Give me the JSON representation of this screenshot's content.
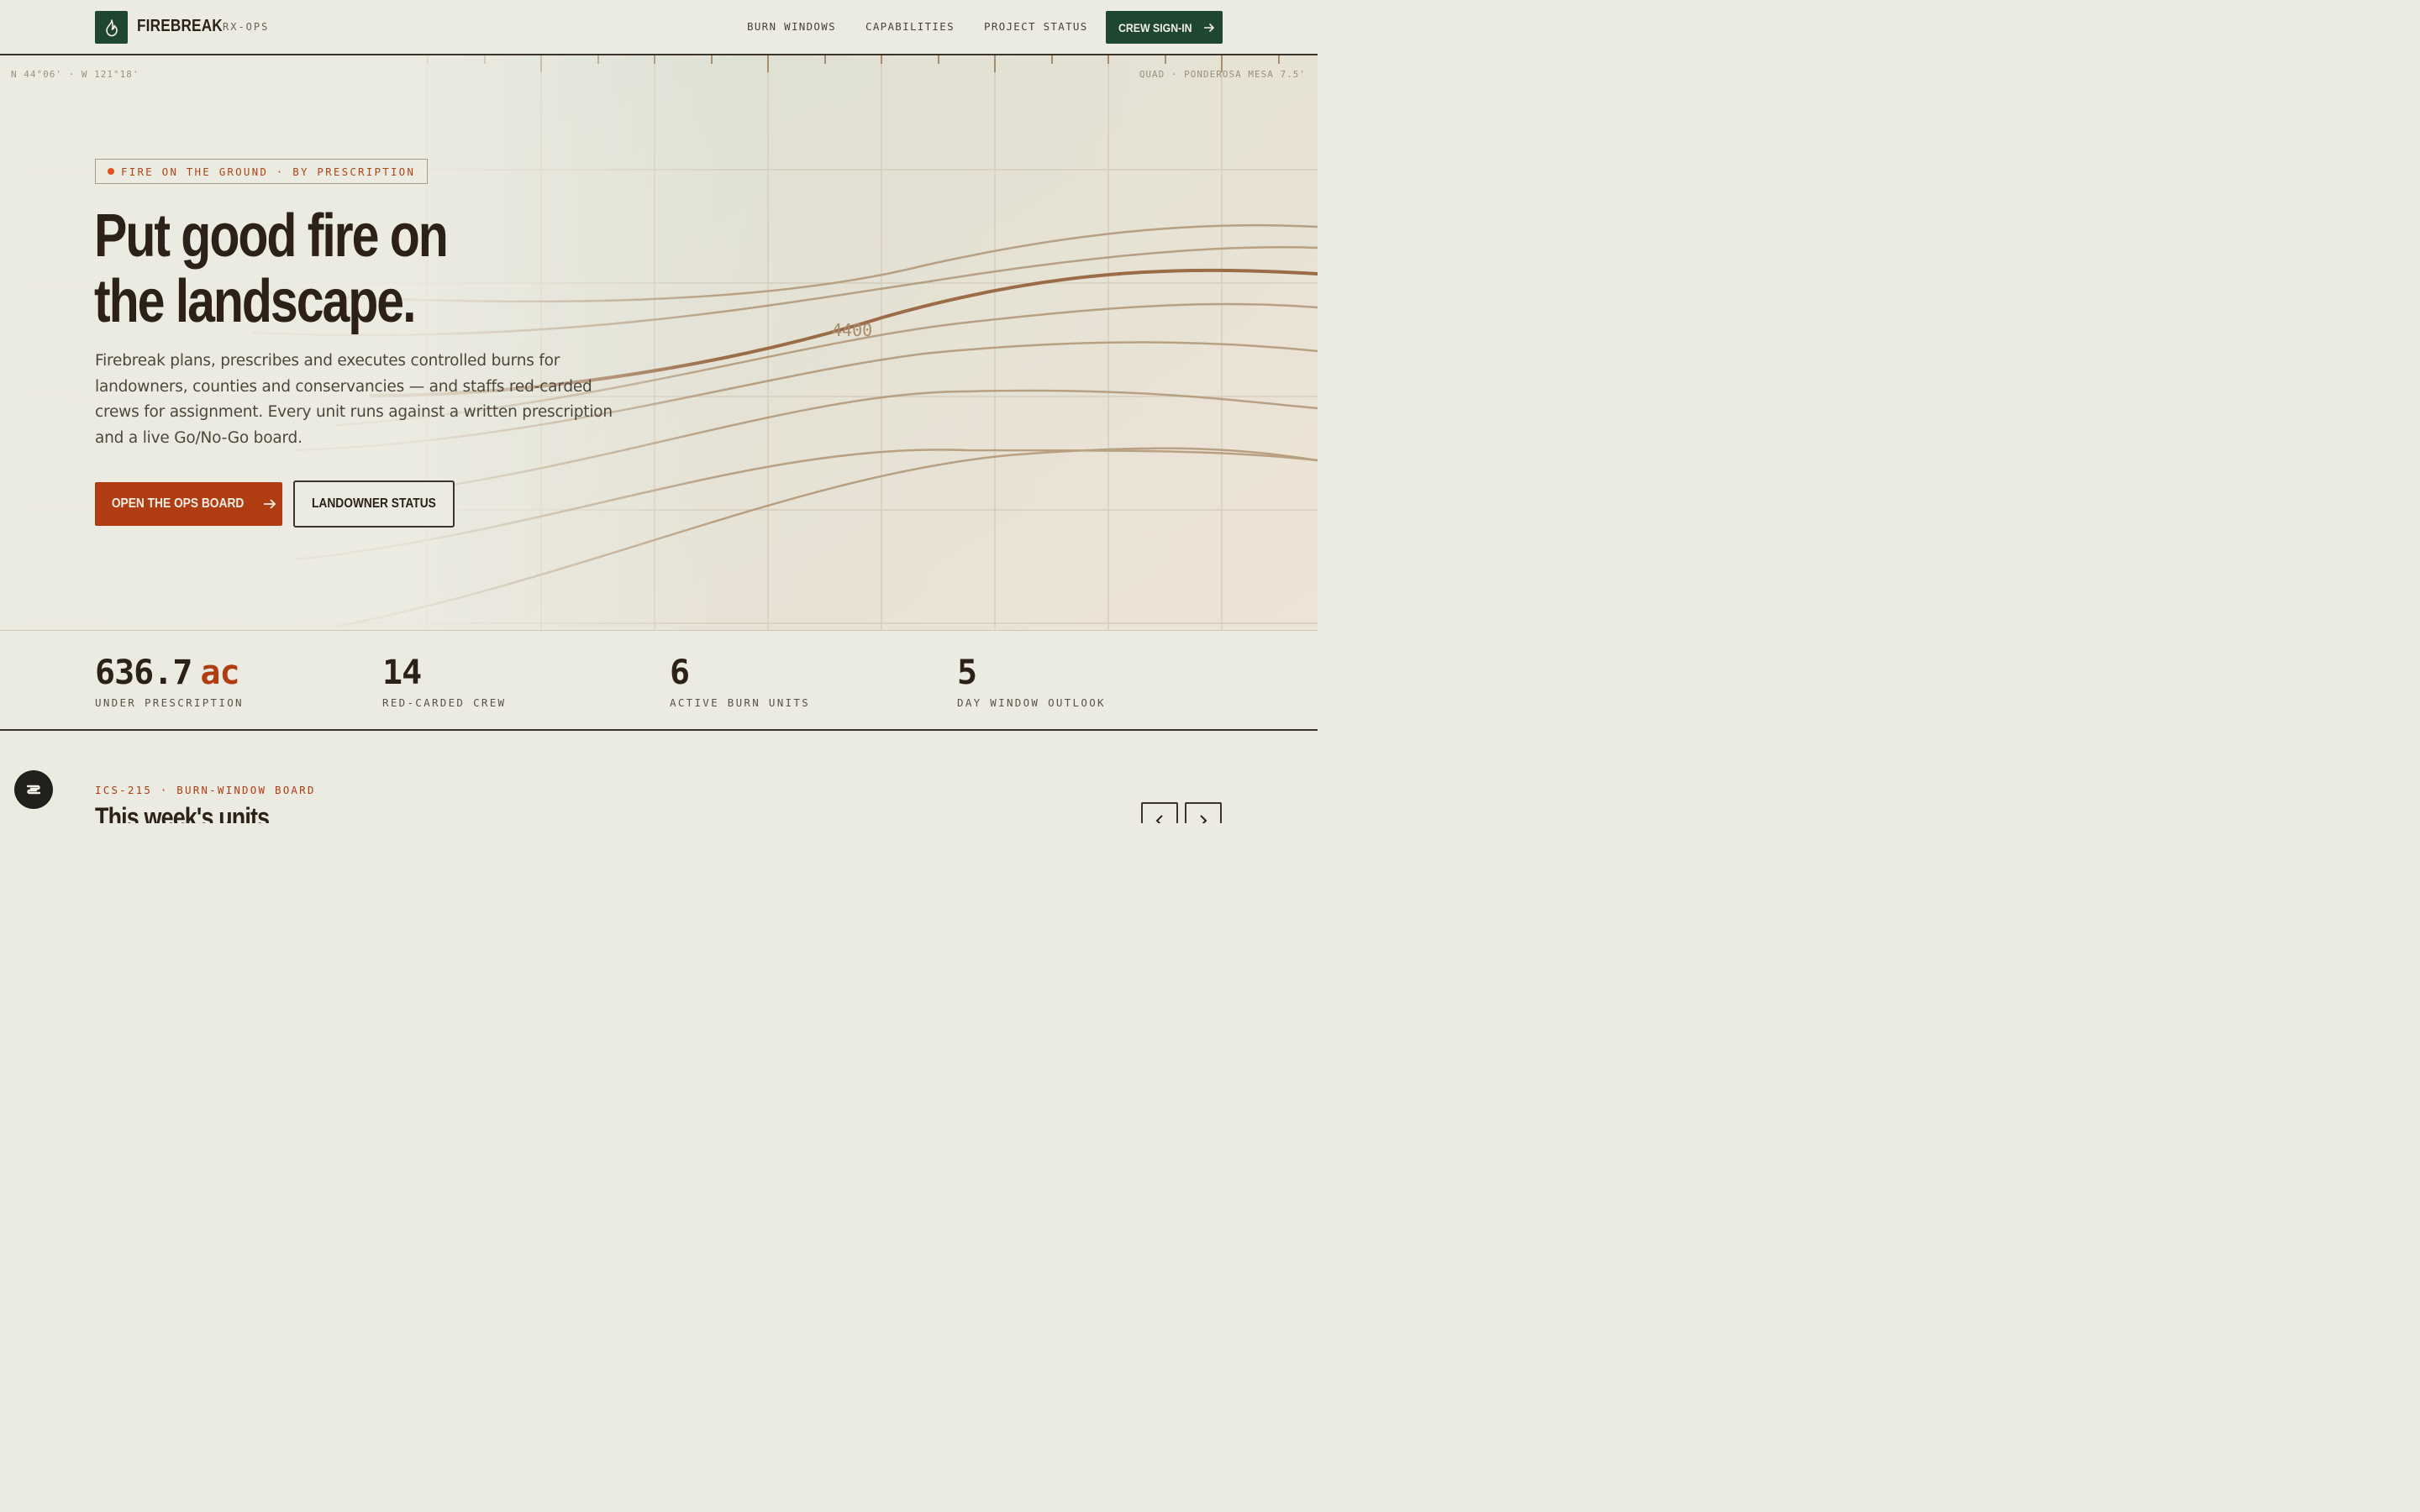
{
  "header": {
    "brand": "FIREBREAK",
    "brand_sub": "RX-OPS",
    "nav": [
      {
        "label": "BURN WINDOWS"
      },
      {
        "label": "CAPABILITIES"
      },
      {
        "label": "PROJECT STATUS"
      }
    ],
    "cta": "CREW SIGN-IN",
    "logo_icon": "flame-icon"
  },
  "hero": {
    "coord_left": "N 44°06' · W 121°18'",
    "coord_right": "QUAD · PONDEROSA MESA 7.5'",
    "tag": "FIRE ON THE GROUND · BY PRESCRIPTION",
    "headline_line1": "Put good fire on",
    "headline_line2": "the landscape.",
    "lead": "Firebreak plans, prescribes and executes controlled burns for landowners, counties and conservancies — and staffs red-carded crews for assignment. Every unit runs against a written prescription and a live Go/No-Go board.",
    "contour_label": "4400",
    "primary_cta": "OPEN THE OPS BOARD",
    "secondary_cta": "LANDOWNER STATUS"
  },
  "stats": [
    {
      "value": "636.7",
      "unit": "ac",
      "label": "UNDER PRESCRIPTION"
    },
    {
      "value": "14",
      "unit": "",
      "label": "RED-CARDED CREW"
    },
    {
      "value": "6",
      "unit": "",
      "label": "ACTIVE BURN UNITS"
    },
    {
      "value": "5",
      "unit": "",
      "label": "DAY WINDOW OUTLOOK"
    }
  ],
  "section": {
    "kicker": "ICS-215 · BURN-WINDOW BOARD",
    "title": "This week's units"
  },
  "colors": {
    "accent": "#b03d12",
    "brand_green": "#1e4631",
    "ink": "#2b2118"
  }
}
